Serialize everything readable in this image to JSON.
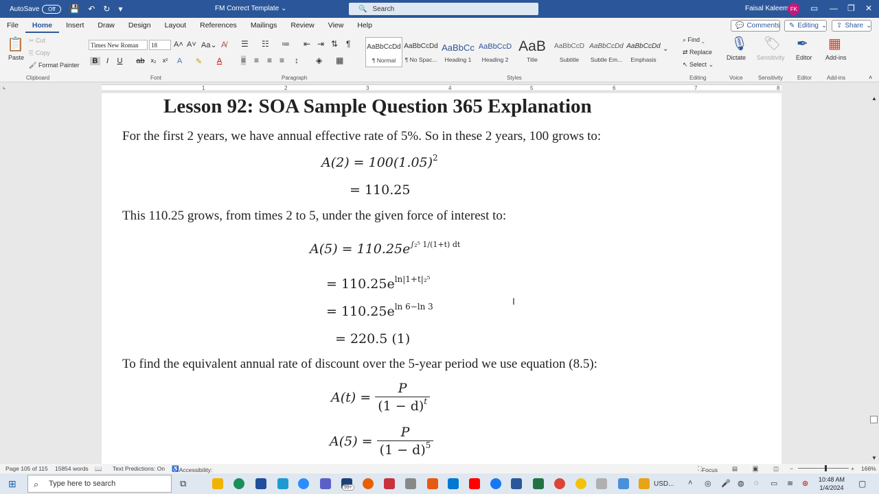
{
  "titlebar": {
    "autosave_label": "AutoSave",
    "autosave_state": "Off",
    "doc_title": "FM Correct Template",
    "search_placeholder": "Search",
    "user_name": "Faisal Kaleem",
    "user_initials": "FK"
  },
  "menu": {
    "tabs": [
      "File",
      "Home",
      "Insert",
      "Draw",
      "Design",
      "Layout",
      "References",
      "Mailings",
      "Review",
      "View",
      "Help"
    ],
    "comments_label": "Comments",
    "editing_label": "Editing",
    "share_label": "Share"
  },
  "ribbon": {
    "clipboard": {
      "paste": "Paste",
      "cut": "Cut",
      "copy": "Copy",
      "format_painter": "Format Painter",
      "label": "Clipboard"
    },
    "font": {
      "name": "Times New Roman",
      "size": "18",
      "label": "Font",
      "case": "Aa"
    },
    "paragraph": {
      "label": "Paragraph"
    },
    "styles": {
      "label": "Styles",
      "items": [
        {
          "sample": "AaBbCcDd",
          "name": "¶ Normal"
        },
        {
          "sample": "AaBbCcDd",
          "name": "¶ No Spac..."
        },
        {
          "sample": "AaBbCc",
          "name": "Heading 1"
        },
        {
          "sample": "AaBbCcD",
          "name": "Heading 2"
        },
        {
          "sample": "AaB",
          "name": "Title"
        },
        {
          "sample": "AaBbCcD",
          "name": "Subtitle"
        },
        {
          "sample": "AaBbCcDd",
          "name": "Subtle Em..."
        },
        {
          "sample": "AaBbCcDd",
          "name": "Emphasis"
        }
      ]
    },
    "editing": {
      "find": "Find",
      "replace": "Replace",
      "select": "Select",
      "label": "Editing"
    },
    "voice": {
      "dictate": "Dictate",
      "label": "Voice"
    },
    "sensitivity": {
      "button": "Sensitivity",
      "label": "Sensitivity"
    },
    "editor": {
      "button": "Editor",
      "label": "Editor"
    },
    "addins": {
      "button": "Add-ins",
      "label": "Add-ins"
    }
  },
  "ruler_numbers": [
    "1",
    "2",
    "3",
    "4",
    "5",
    "6",
    "7",
    "8"
  ],
  "document": {
    "heading": "Lesson 92:  SOA Sample Question 365 Explanation",
    "para1": "For the first 2 years, we have annual effective rate of 5%.  So in these 2 years, 100 grows to:",
    "eq1a": "A(2) = 100(1.05)",
    "eq1a_exp": "2",
    "eq1b": "= 110.25",
    "para2": "This 110.25 grows, from times 2 to 5, under the given force of interest to:",
    "eq2a_lhs": "A(5) = 110.25e",
    "eq2a_exp": "∫₂⁵ 1/(1+t) dt",
    "eq2b": "= 110.25e",
    "eq2b_exp": "ln|1+t|₂⁵",
    "eq2c": "= 110.25e",
    "eq2c_exp": "ln 6−ln 3",
    "eq2d": "= 220.5     (1)",
    "para3": "To find the equivalent annual rate of discount over the 5-year period we use equation (8.5):",
    "eq3_lhs": "A(t) =",
    "eq3_num": "P",
    "eq3_den": "(1 − d)",
    "eq3_den_exp": "t",
    "eq4_lhs": "A(5) =",
    "eq4_num": "P",
    "eq4_den": "(1 − d)",
    "eq4_den_exp": "5"
  },
  "status": {
    "page": "Page 105 of 115",
    "words": "15854 words",
    "text_predictions": "Text Predictions: On",
    "accessibility": "Accessibility: Investigate",
    "focus": "Focus",
    "zoom": "166%"
  },
  "taskbar": {
    "search_placeholder": "Type here to search",
    "badge": "99+",
    "tray_text": "USD...",
    "time": "10:48 AM",
    "date": "1/4/2024"
  }
}
